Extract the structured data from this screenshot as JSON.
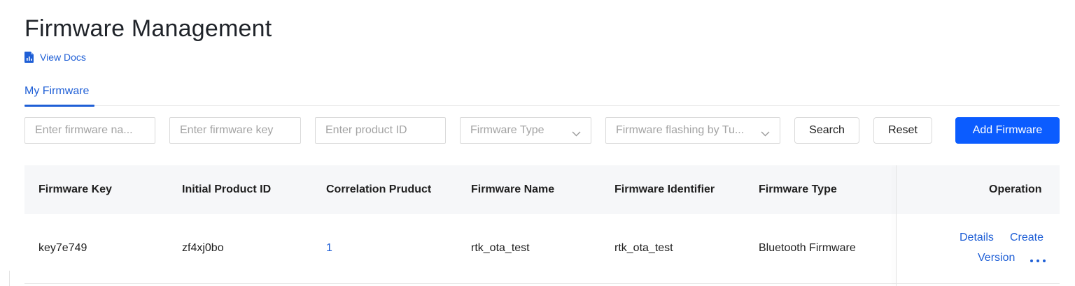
{
  "page": {
    "title": "Firmware Management",
    "docs_link": "View Docs"
  },
  "tabs": [
    {
      "label": "My Firmware",
      "active": true
    }
  ],
  "filters": {
    "firmware_name": {
      "placeholder": "Enter firmware na..."
    },
    "firmware_key": {
      "placeholder": "Enter firmware key"
    },
    "product_id": {
      "placeholder": "Enter product ID"
    },
    "firmware_type": {
      "value": "Firmware Type"
    },
    "flashing": {
      "value": "Firmware flashing by Tu..."
    }
  },
  "buttons": {
    "search": "Search",
    "reset": "Reset",
    "add": "Add Firmware"
  },
  "table": {
    "columns": [
      "Firmware Key",
      "Initial Product ID",
      "Correlation Pruduct",
      "Firmware Name",
      "Firmware Identifier",
      "Firmware Type",
      "Operation"
    ],
    "rows": [
      {
        "firmware_key": "key7e749",
        "initial_product_id": "zf4xj0bo",
        "correlation_product": "1",
        "firmware_name": "rtk_ota_test",
        "firmware_identifier": "rtk_ota_test",
        "firmware_type": "Bluetooth Firmware",
        "operations": {
          "details": "Details",
          "create": "Create",
          "version": "Version"
        }
      }
    ]
  },
  "colors": {
    "accent": "#1f5fd6",
    "primary_button": "#0b5cff",
    "header_bg": "#f6f7f9"
  },
  "icons": {
    "docs": "document-chart-icon",
    "dropdown": "chevron-down-icon",
    "more": "more-horizontal-icon"
  }
}
